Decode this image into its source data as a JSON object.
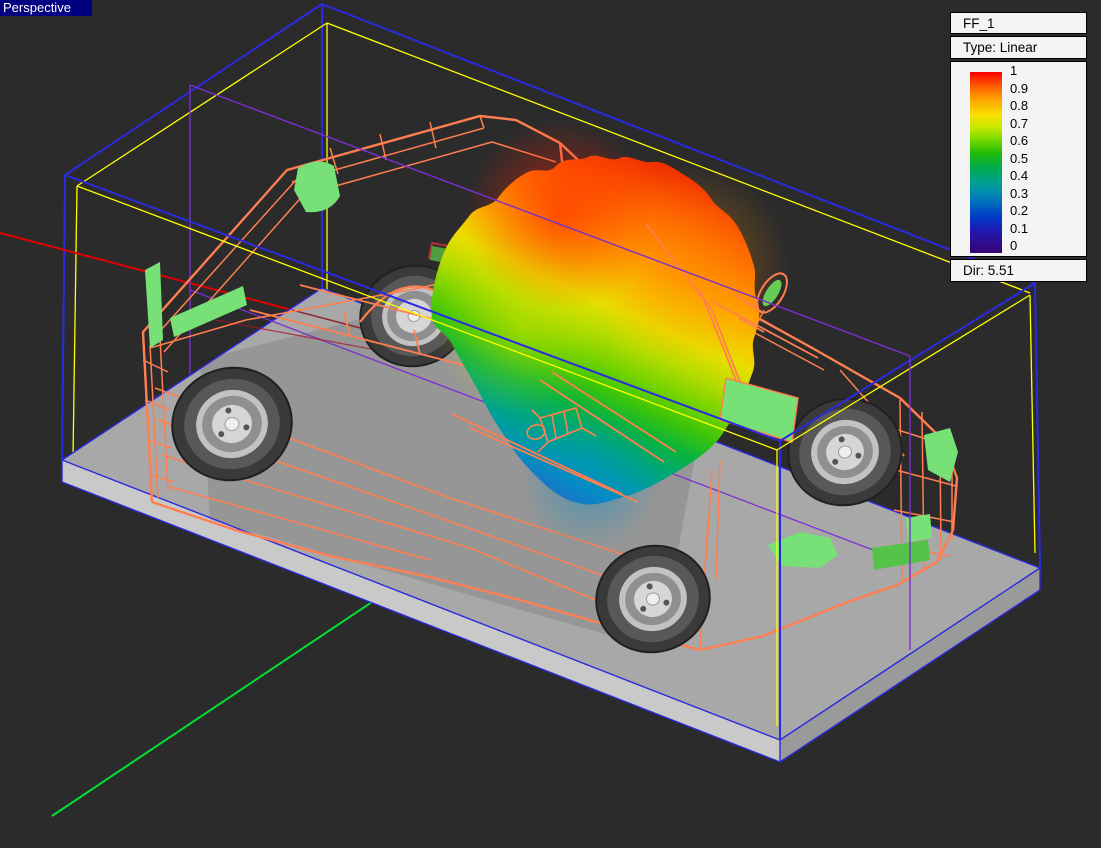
{
  "viewport": {
    "label": "Perspective",
    "background_color": "#2b2b2b"
  },
  "legend": {
    "title": "FF_1",
    "type_label": "Type: Linear",
    "dir_label": "Dir: 5.51",
    "scale_ticks": [
      "1",
      "0.9",
      "0.8",
      "0.7",
      "0.6",
      "0.5",
      "0.4",
      "0.3",
      "0.2",
      "0.1",
      "0"
    ],
    "scale_min": 0,
    "scale_max": 1,
    "colorbar_top_color": "#fa0000",
    "colorbar_bottom_color": "#380570"
  },
  "scene": {
    "model": "wireframe-van-with-farfield-pattern",
    "colors": {
      "bounding_box_blue": "#2a2ae0",
      "inner_box_yellow": "#ffff00",
      "farfield_box_purple": "#7a2fd0",
      "axis_x_red": "#e10000",
      "axis_y_green": "#00e132",
      "car_wireframe_orange": "#ff7f50",
      "glass_green": "#77e077",
      "ground_plane_gray": "#a8a8a8",
      "perspective_label_bg": "#000080"
    }
  }
}
